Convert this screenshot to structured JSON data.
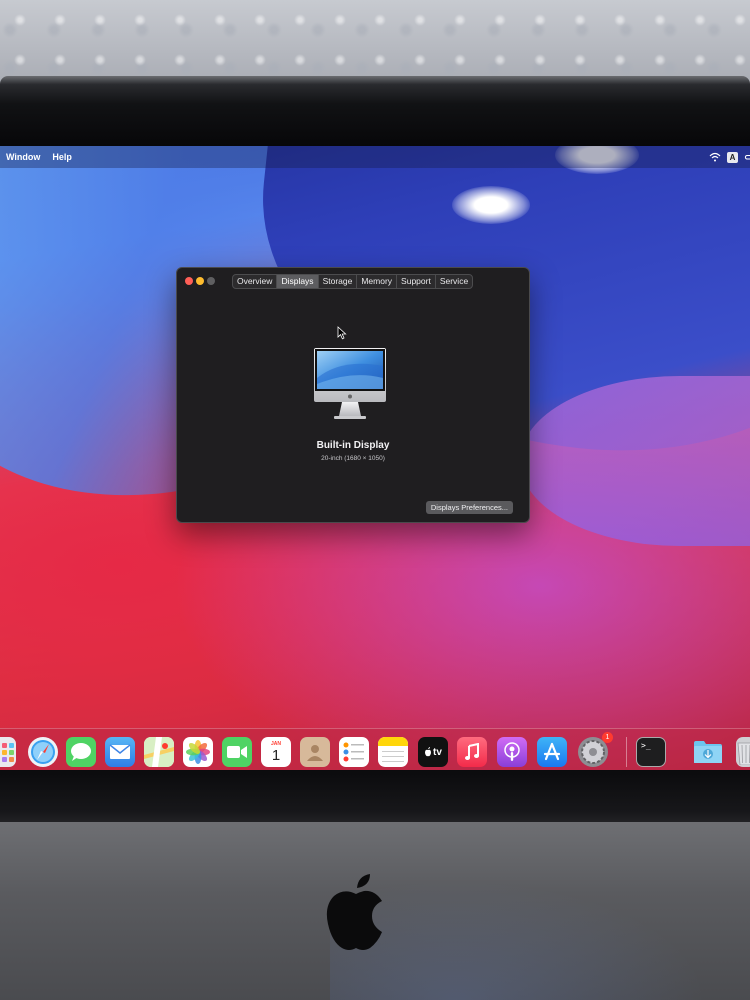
{
  "menubar": {
    "items": [
      "Window",
      "Help"
    ],
    "input_source": "A"
  },
  "window": {
    "tabs": [
      "Overview",
      "Displays",
      "Storage",
      "Memory",
      "Support",
      "Service"
    ],
    "selected_tab": "Displays",
    "display_name": "Built-in Display",
    "display_size": "20-inch (1680 × 1050)",
    "prefs_button": "Displays Preferences..."
  },
  "dock": {
    "icons": [
      "launchpad-icon",
      "safari-icon",
      "messages-icon",
      "mail-icon",
      "maps-icon",
      "photos-icon",
      "facetime-icon",
      "calendar-icon",
      "contacts-icon",
      "reminders-icon",
      "notes-icon",
      "apple-tv-icon",
      "music-icon",
      "podcasts-icon",
      "app-store-icon",
      "system-preferences-icon",
      "terminal-icon",
      "downloads-folder-icon",
      "trash-icon"
    ],
    "calendar_month": "JAN",
    "calendar_day": "1",
    "tv_label": "tv",
    "settings_badge": "1",
    "terminal_prompt": ">_"
  }
}
